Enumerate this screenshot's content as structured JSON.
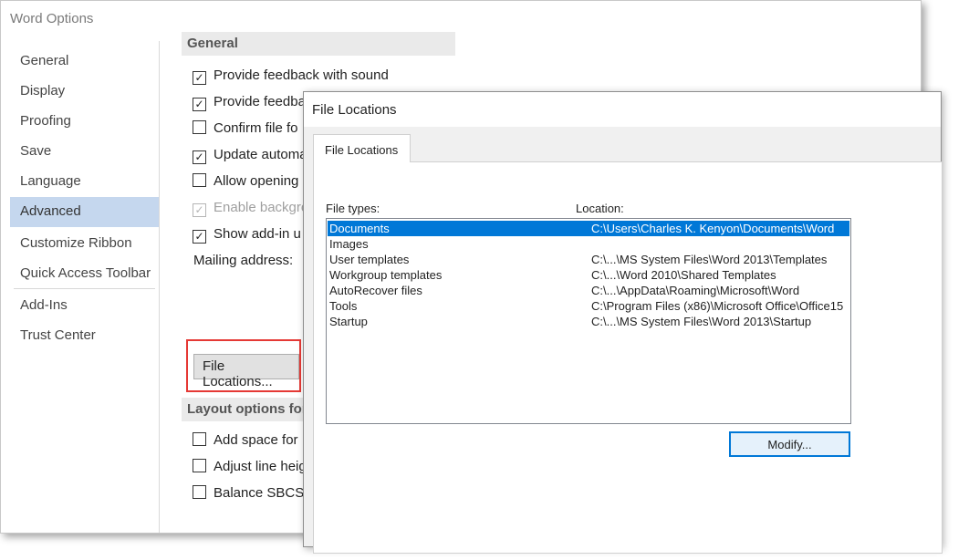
{
  "window": {
    "title": "Word Options"
  },
  "nav": {
    "items": [
      {
        "label": "General"
      },
      {
        "label": "Display"
      },
      {
        "label": "Proofing"
      },
      {
        "label": "Save"
      },
      {
        "label": "Language"
      },
      {
        "label": "Advanced",
        "selected": true
      },
      {
        "label": "Customize Ribbon"
      },
      {
        "label": "Quick Access Toolbar"
      },
      {
        "label": "Add-Ins"
      },
      {
        "label": "Trust Center"
      }
    ]
  },
  "general_section": {
    "header": "General",
    "options": [
      {
        "label": "Provide feedback with sound",
        "checked": true
      },
      {
        "label": "Provide feedba",
        "checked": true
      },
      {
        "label": "Confirm file fo",
        "checked": false
      },
      {
        "label": "Update automa",
        "checked": true
      },
      {
        "label": "Allow opening",
        "checked": false
      },
      {
        "label": "Enable backgro",
        "checked": true,
        "disabled": true
      },
      {
        "label": "Show add-in u",
        "checked": true
      }
    ],
    "mailing_label": "Mailing address:",
    "file_locations_button": "File Locations..."
  },
  "layout_section": {
    "header": "Layout options for",
    "options": [
      {
        "label": "Add space for",
        "checked": false
      },
      {
        "label": "Adjust line heig",
        "checked": false
      },
      {
        "label": "Balance SBCS c",
        "checked": false
      }
    ]
  },
  "dialog": {
    "title": "File Locations",
    "tab": "File Locations",
    "file_types_header": "File types:",
    "location_header": "Location:",
    "rows": [
      {
        "type": "Documents",
        "location": "C:\\Users\\Charles K. Kenyon\\Documents\\Word",
        "selected": true
      },
      {
        "type": "Images",
        "location": ""
      },
      {
        "type": "User templates",
        "location": "C:\\...\\MS System Files\\Word 2013\\Templates"
      },
      {
        "type": "Workgroup templates",
        "location": "C:\\...\\Word 2010\\Shared Templates"
      },
      {
        "type": "AutoRecover files",
        "location": "C:\\...\\AppData\\Roaming\\Microsoft\\Word"
      },
      {
        "type": "Tools",
        "location": "C:\\Program Files (x86)\\Microsoft Office\\Office15"
      },
      {
        "type": "Startup",
        "location": "C:\\...\\MS System Files\\Word 2013\\Startup"
      }
    ],
    "modify_button": "Modify..."
  },
  "colors": {
    "nav_selected": "#c5d7ee",
    "list_selected": "#0078d7",
    "highlight_box": "#e53935"
  }
}
